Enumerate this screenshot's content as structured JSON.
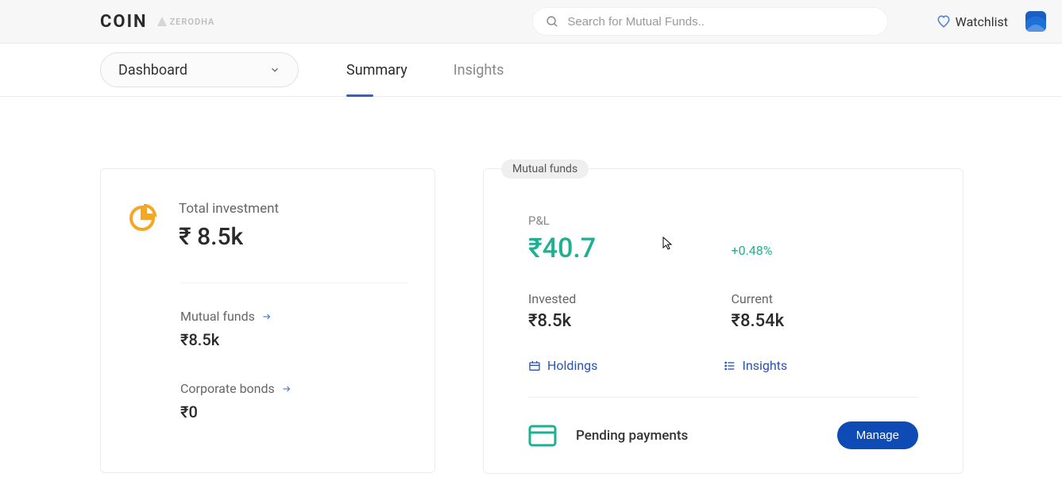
{
  "header": {
    "logo": "COIN",
    "sublogo": "ZERODHA",
    "search_placeholder": "Search for Mutual Funds..",
    "watchlist": "Watchlist"
  },
  "nav": {
    "dashboard": "Dashboard",
    "tabs": {
      "summary": "Summary",
      "insights": "Insights"
    }
  },
  "total_investment": {
    "label": "Total investment",
    "value": "₹ 8.5k"
  },
  "breakdown": {
    "mutual_funds": {
      "label": "Mutual funds",
      "value": "₹8.5k"
    },
    "corporate_bonds": {
      "label": "Corporate bonds",
      "value": "₹0"
    }
  },
  "mf_card": {
    "badge": "Mutual funds",
    "pnl_label": "P&L",
    "pnl_value": "₹40.7",
    "pnl_pct": "+0.48%",
    "invested_label": "Invested",
    "invested_value": "₹8.5k",
    "current_label": "Current",
    "current_value": "₹8.54k",
    "holdings_link": "Holdings",
    "insights_link": "Insights",
    "pending_label": "Pending payments",
    "manage_btn": "Manage"
  },
  "colors": {
    "accent_blue": "#2f5fd6",
    "profit_green": "#1eb091",
    "chart_yellow": "#f5a623",
    "avatar_blue": "#1f6fd9"
  }
}
